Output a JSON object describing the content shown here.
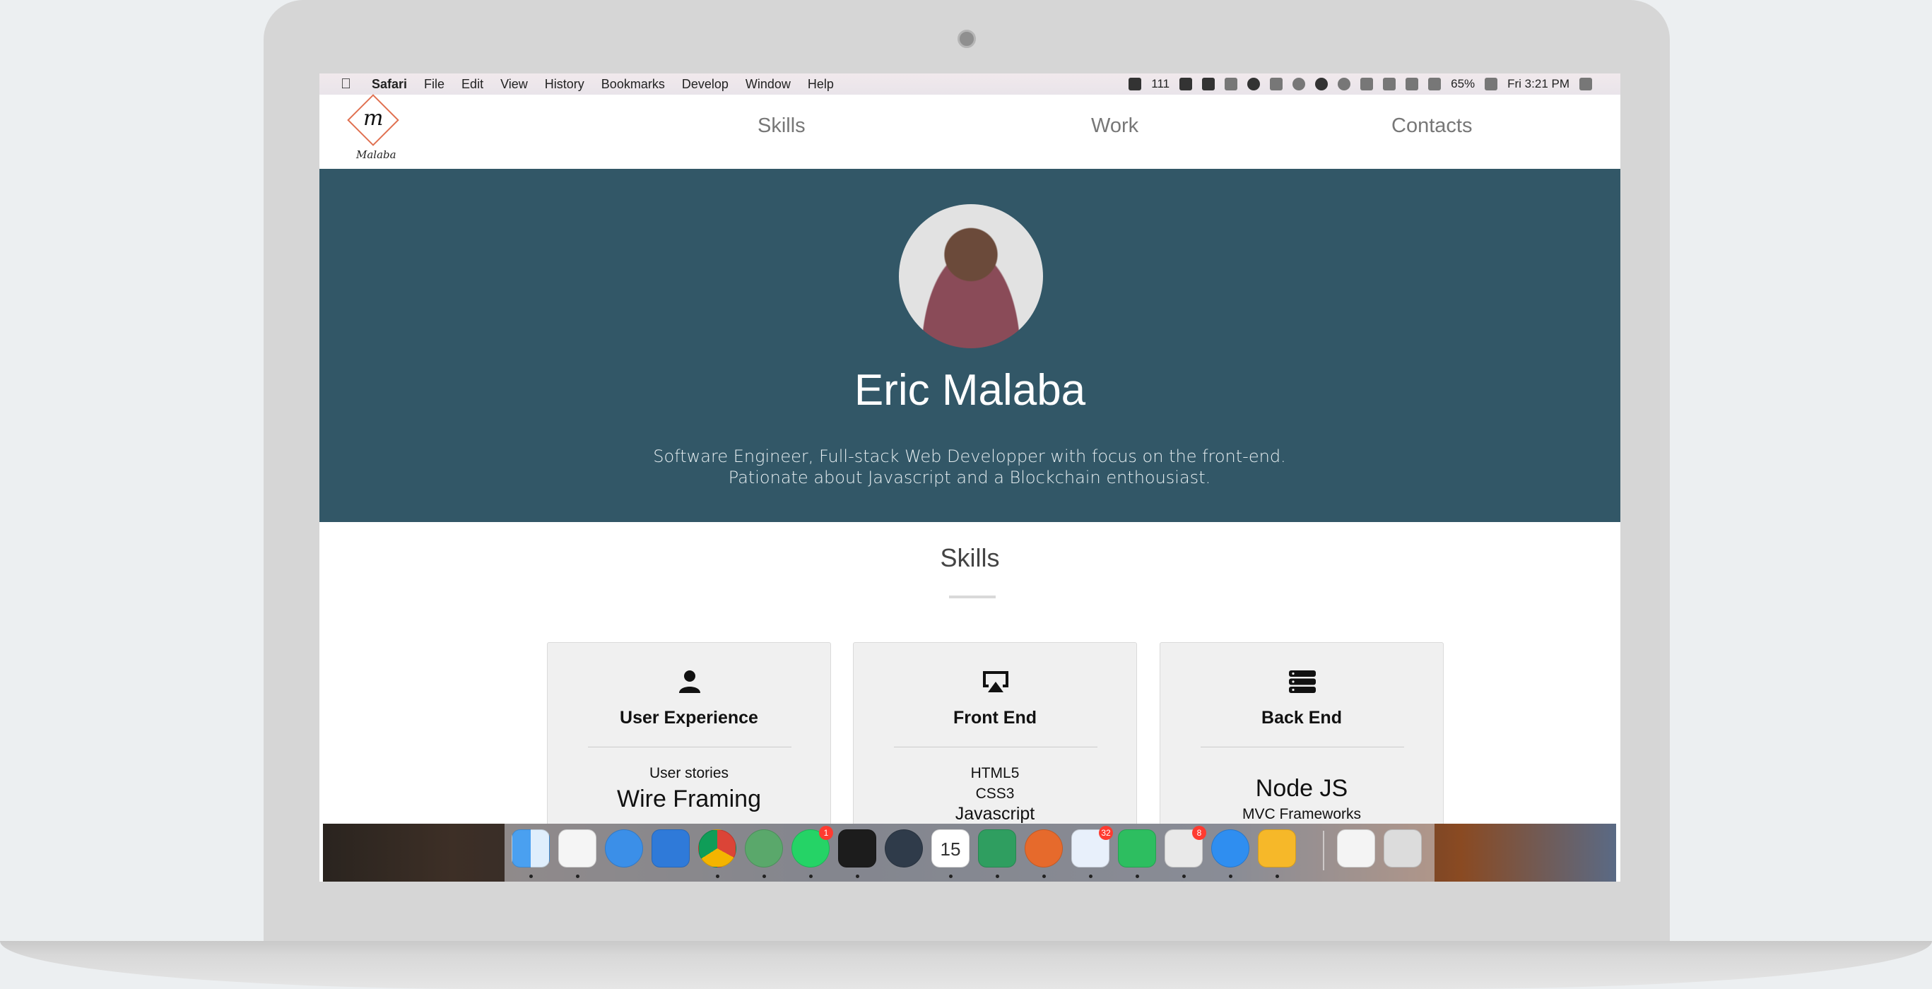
{
  "menubar": {
    "app": "Safari",
    "items": [
      "File",
      "Edit",
      "View",
      "History",
      "Bookmarks",
      "Develop",
      "Window",
      "Help"
    ],
    "status_count": "111",
    "battery": "65%",
    "clock": "Fri 3:21 PM"
  },
  "site": {
    "logo_text": "Malaba",
    "logo_letter": "m",
    "nav": [
      "Skills",
      "Work",
      "Contacts"
    ]
  },
  "hero": {
    "name": "Eric Malaba",
    "bio": "Software Engineer, Full-stack Web Developper with focus on the front-end. Pationate about Javascript and a Blockchain enthousiast."
  },
  "skills": {
    "title": "Skills",
    "cards": [
      {
        "icon": "user-icon",
        "title": "User Experience",
        "items": [
          "User stories",
          "Wire Framing"
        ]
      },
      {
        "icon": "airplay-icon",
        "title": "Front End",
        "items": [
          "HTML5",
          "CSS3",
          "Javascript"
        ]
      },
      {
        "icon": "server-icon",
        "title": "Back End",
        "items": [
          "Node JS",
          "MVC Frameworks"
        ]
      }
    ]
  },
  "dock": {
    "calendar_day": "15",
    "badges": {
      "whatsapp": "1",
      "mail": "32",
      "slack": "8"
    }
  },
  "colors": {
    "hero_bg": "#325767",
    "nav_text": "#777777",
    "logo_accent": "#e07050"
  }
}
